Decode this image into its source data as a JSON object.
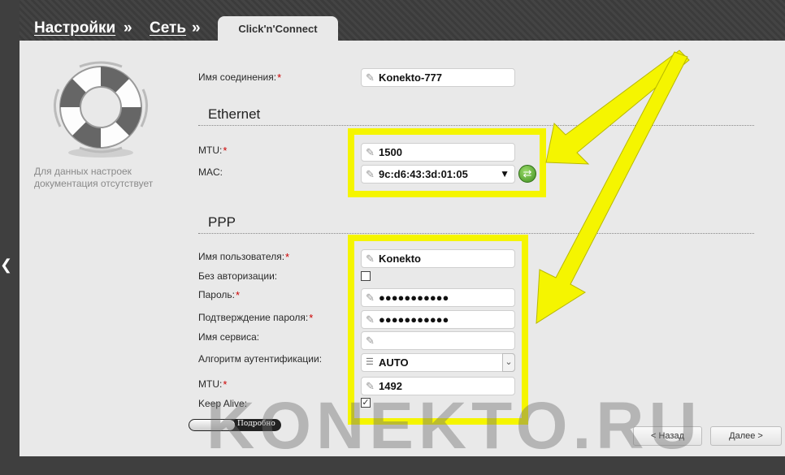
{
  "breadcrumb": {
    "item1": "Настройки",
    "sep1": "»",
    "item2": "Сеть",
    "sep2": "»"
  },
  "tab": {
    "label": "Click'n'Connect"
  },
  "sidebar": {
    "help_text": "Для данных настроек документация отсутствует",
    "icon": "lifebuoy-icon"
  },
  "form": {
    "connection_name": {
      "label": "Имя соединения:",
      "value": "Konekto-777"
    },
    "ethernet": {
      "title": "Ethernet",
      "mtu": {
        "label": "MTU:",
        "value": "1500"
      },
      "mac": {
        "label": "MAC:",
        "value": "9c:d6:43:3d:01:05"
      }
    },
    "ppp": {
      "title": "PPP",
      "username": {
        "label": "Имя пользователя:",
        "value": "Konekto"
      },
      "no_auth": {
        "label": "Без авторизации:",
        "checked": false
      },
      "password": {
        "label": "Пароль:",
        "value": "●●●●●●●●●●●"
      },
      "password_confirm": {
        "label": "Подтверждение пароля:",
        "value": "●●●●●●●●●●●"
      },
      "service_name": {
        "label": "Имя сервиса:",
        "value": ""
      },
      "auth_algorithm": {
        "label": "Алгоритм аутентификации:",
        "value": "AUTO"
      },
      "mtu": {
        "label": "MTU:",
        "value": "1492"
      },
      "keep_alive": {
        "label": "Keep Alive:",
        "checked": true
      }
    },
    "required_mark": "*"
  },
  "details_toggle": {
    "label": "Подробно"
  },
  "buttons": {
    "back": "< Назад",
    "next": "Далее >"
  },
  "watermark": "KONEKTO.RU",
  "colors": {
    "highlight": "#f5f500",
    "required": "#cc0000"
  }
}
